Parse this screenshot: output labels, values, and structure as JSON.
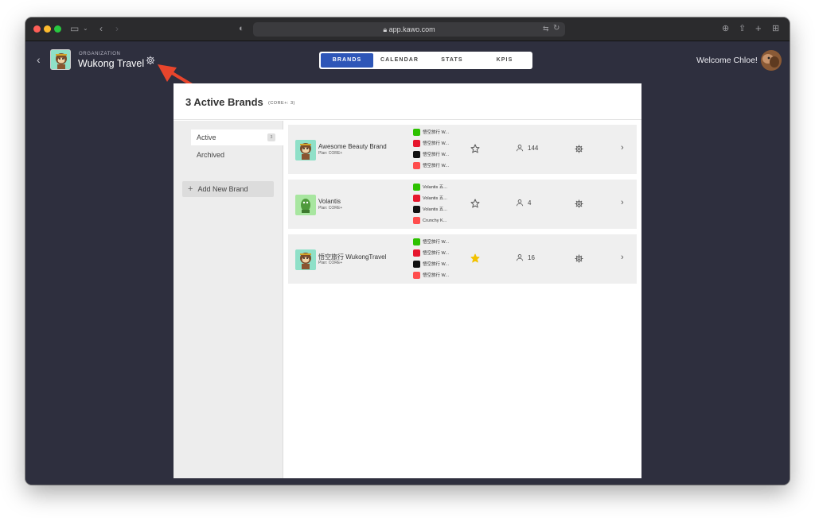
{
  "browser": {
    "url": "app.kawo.com",
    "traffic_lights": [
      "#ff5f57",
      "#febc2e",
      "#28c840"
    ]
  },
  "header": {
    "org_caption": "ORGANIZATION",
    "org_name": "Wukong Travel",
    "welcome": "Welcome Chloe!"
  },
  "tabs": [
    {
      "label": "BRANDS",
      "active": true
    },
    {
      "label": "CALENDAR",
      "active": false
    },
    {
      "label": "STATS",
      "active": false
    },
    {
      "label": "KPIS",
      "active": false
    }
  ],
  "panel": {
    "title": "3 Active Brands",
    "subtitle": "(CORE+: 3)"
  },
  "sidebar": {
    "items": [
      {
        "label": "Active",
        "count": "3"
      },
      {
        "label": "Archived"
      }
    ],
    "add_label": "Add New Brand"
  },
  "brands": [
    {
      "name": "Awesome Beauty Brand",
      "plan": "Plan: CORE+",
      "accounts": [
        "悟空旅行 W...",
        "悟空旅行 W...",
        "悟空旅行 W...",
        "悟空旅行 W..."
      ],
      "starred": false,
      "users": "144"
    },
    {
      "name": "Volantis",
      "plan": "Plan: CORE+",
      "accounts": [
        "Volantis 五...",
        "Volantis 五...",
        "Volantis 五...",
        "Crunchy K..."
      ],
      "starred": false,
      "users": "4"
    },
    {
      "name": "悟空旅行 WukongTravel",
      "plan": "Plan: CORE+",
      "accounts": [
        "悟空旅行 W...",
        "悟空旅行 W...",
        "悟空旅行 W...",
        "悟空旅行 W..."
      ],
      "starred": true,
      "users": "16"
    }
  ],
  "colors": {
    "accent": "#2e56b8",
    "background": "#2e2f3e",
    "arrow": "#e8452c",
    "star_filled": "#f2c200",
    "wechat": "#2dc100",
    "weibo": "#e6162d",
    "douyin": "#111111",
    "xiaohongshu": "#ff4d4d"
  },
  "platform_icons": [
    "wechat-icon",
    "weibo-icon",
    "douyin-icon",
    "xiaohongshu-icon"
  ]
}
